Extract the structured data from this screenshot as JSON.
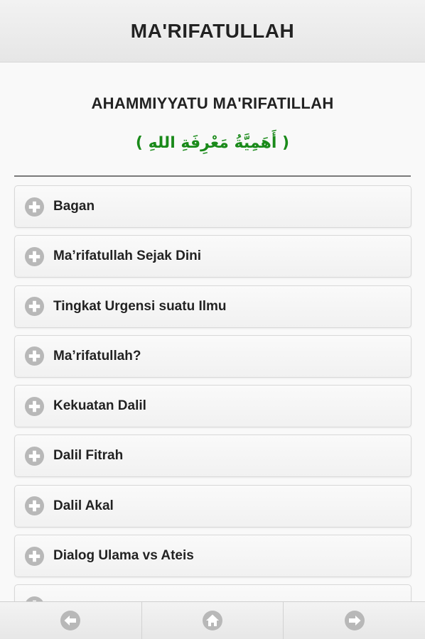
{
  "header": {
    "title": "MA'RIFATULLAH"
  },
  "main": {
    "title": "AHAMMIYYATU MA'RIFATILLAH",
    "arabic_title": "( أَهَمِيَّةُ مَعْرِفَةِ اللهِ )",
    "items": [
      {
        "label": "Bagan",
        "icon": "plus-icon"
      },
      {
        "label": "Ma’rifatullah Sejak Dini",
        "icon": "plus-icon"
      },
      {
        "label": "Tingkat Urgensi suatu Ilmu",
        "icon": "plus-icon"
      },
      {
        "label": "Ma’rifatullah?",
        "icon": "plus-icon"
      },
      {
        "label": "Kekuatan Dalil",
        "icon": "plus-icon"
      },
      {
        "label": "Dalil Fitrah",
        "icon": "plus-icon"
      },
      {
        "label": "Dalil Akal",
        "icon": "plus-icon"
      },
      {
        "label": "Dialog Ulama vs Ateis",
        "icon": "plus-icon"
      },
      {
        "label": "",
        "icon": "plus-icon"
      }
    ]
  },
  "footer": {
    "buttons": [
      {
        "icon": "arrow-left-icon"
      },
      {
        "icon": "home-icon"
      },
      {
        "icon": "arrow-right-icon"
      }
    ]
  },
  "colors": {
    "arabic_text": "#1a8a1a",
    "icon_gray": "#b8b8b8",
    "header_bg": "#ececec"
  }
}
